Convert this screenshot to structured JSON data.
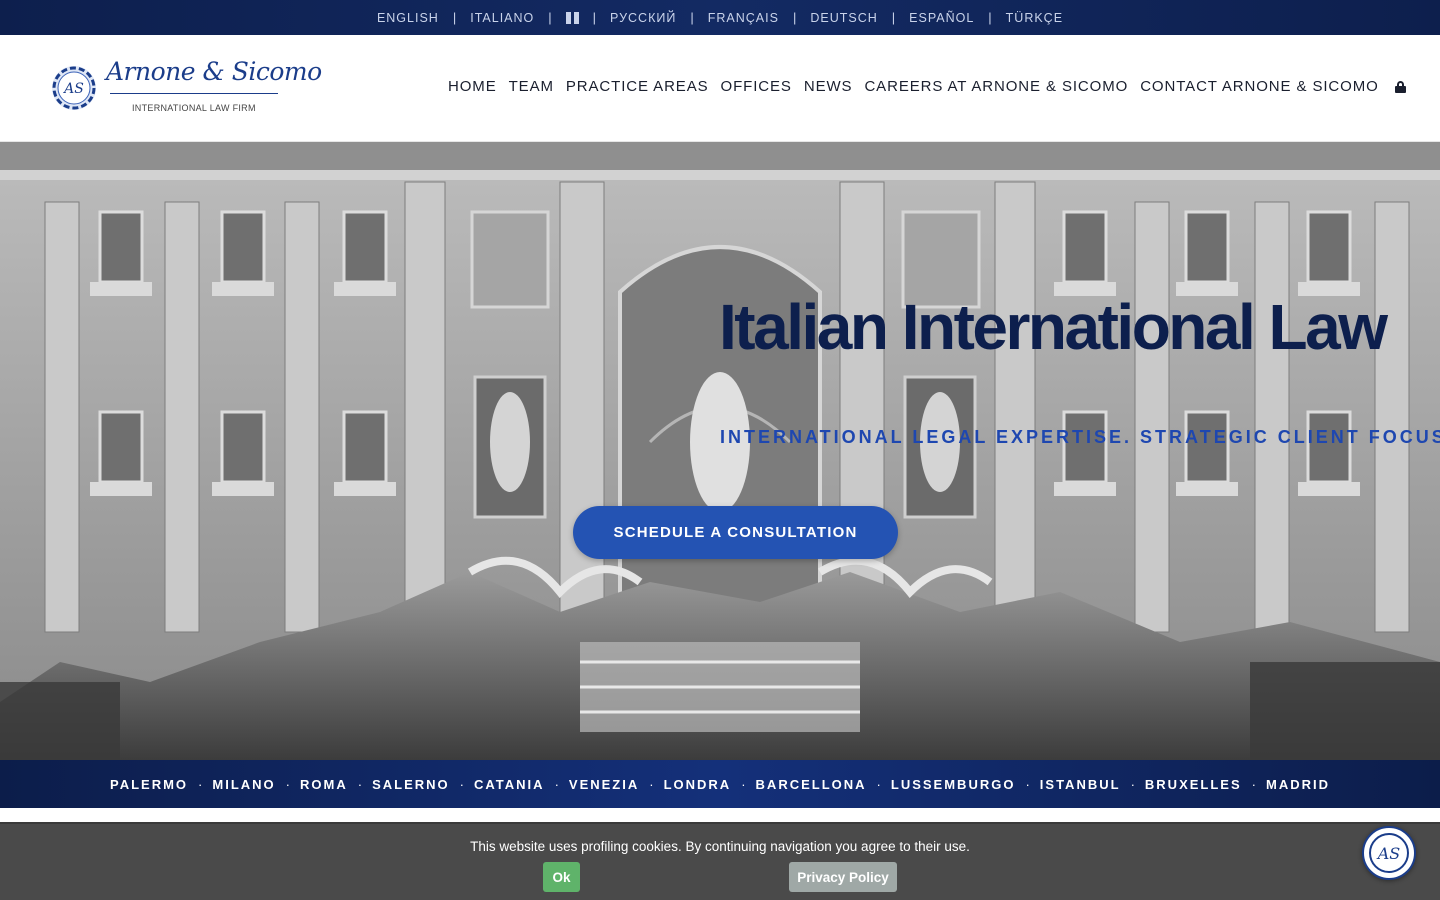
{
  "languages": [
    {
      "label": "ENGLISH"
    },
    {
      "label": "ITALIANO"
    },
    {
      "label": "",
      "icon": "flag-icon"
    },
    {
      "label": "РУССКИЙ"
    },
    {
      "label": "FRANÇAIS"
    },
    {
      "label": "DEUTSCH"
    },
    {
      "label": "ESPAÑOL"
    },
    {
      "label": "TÜRKÇE"
    }
  ],
  "language_separator": "|",
  "logo": {
    "monogram": "AS",
    "name": "Arnone & Sicomo",
    "tagline": "INTERNATIONAL LAW FIRM"
  },
  "nav": {
    "items": [
      "HOME",
      "TEAM",
      "PRACTICE AREAS",
      "OFFICES",
      "NEWS",
      "CAREERS AT ARNONE & SICOMO",
      "CONTACT ARNONE & SICOMO"
    ],
    "lock_icon": "lock-icon"
  },
  "hero": {
    "title": "Italian International Law",
    "subtitle": "INTERNATIONAL LEGAL EXPERTISE. STRATEGIC CLIENT FOCUS.",
    "cta": "SCHEDULE A CONSULTATION",
    "background": "black-and-white photo of the Trevi Fountain, Rome"
  },
  "cities": [
    "PALERMO",
    "MILANO",
    "ROMA",
    "SALERNO",
    "CATANIA",
    "VENEZIA",
    "LONDRA",
    "BARCELLONA",
    "LUSSEMBURGO",
    "ISTANBUL",
    "BRUXELLES",
    "MADRID"
  ],
  "city_separator": "·",
  "cookie_banner": {
    "text": "This website uses profiling cookies. By continuing navigation you agree to their use.",
    "ok_label": "Ok",
    "privacy_label": "Privacy Policy"
  },
  "chat_badge": {
    "icon": "firm-logo-icon"
  },
  "colors": {
    "navy": "#0d1f4d",
    "accent_blue": "#2453b3",
    "subtitle_blue": "#1e47b0",
    "cookie_ok": "#5fb36a",
    "cookie_privacy": "#9fa8a6",
    "cookie_bg": "#4a4a4a"
  }
}
